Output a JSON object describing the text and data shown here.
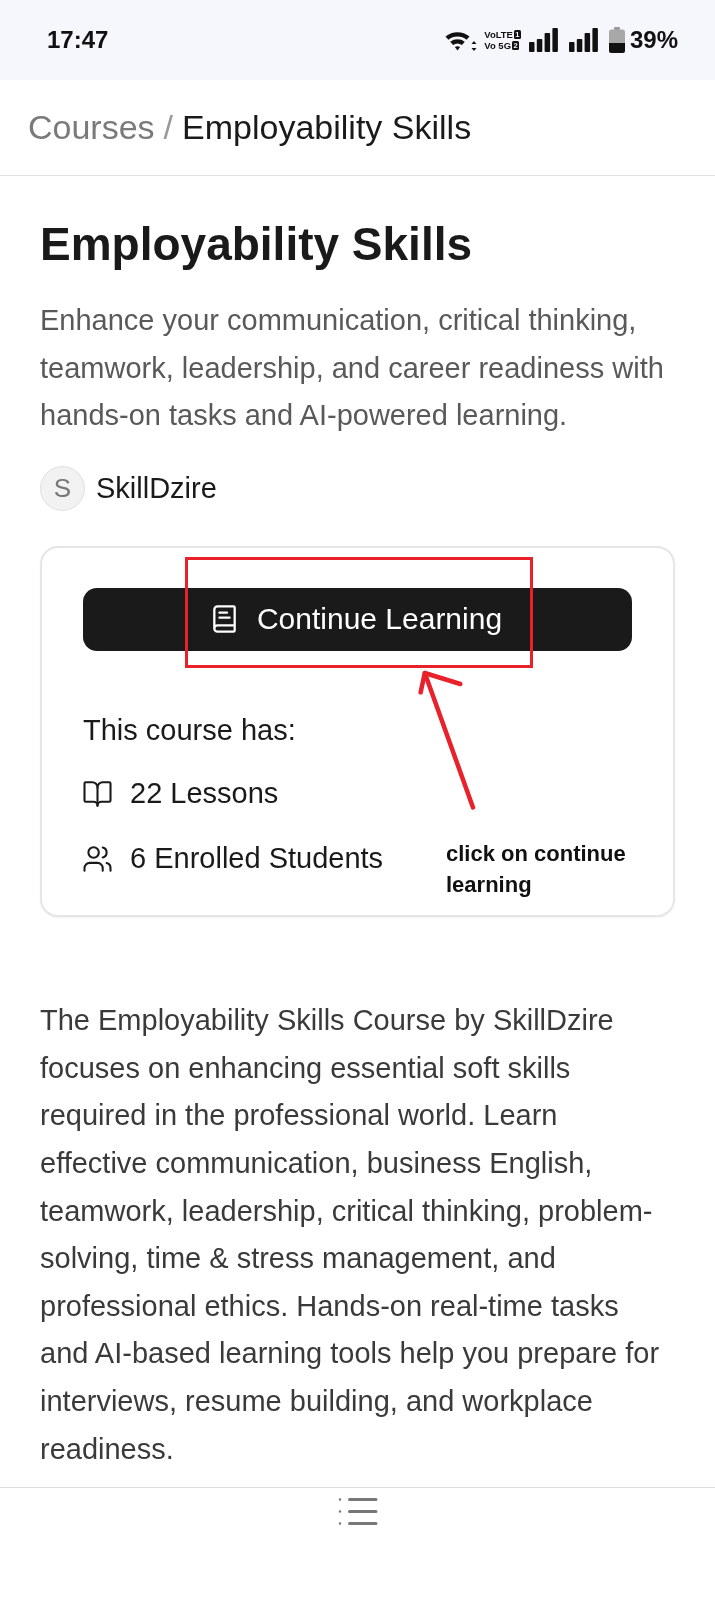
{
  "status_bar": {
    "time": "17:47",
    "networks": [
      {
        "label": "VoLTE",
        "sim": "1"
      },
      {
        "label": "Vo 5G",
        "sim": "2"
      }
    ],
    "battery": "39%"
  },
  "breadcrumb": {
    "items": [
      {
        "label": "Courses",
        "current": false
      },
      {
        "label": "Employability Skills",
        "current": true
      }
    ],
    "separator": "/"
  },
  "course": {
    "title": "Employability Skills",
    "description": "Enhance your communication, critical thinking, teamwork, leadership, and career readiness with hands-on tasks and AI-powered learning.",
    "author": {
      "initial": "S",
      "name": "SkillDzire"
    }
  },
  "card": {
    "button": {
      "label": "Continue Learning"
    },
    "heading": "This course has:",
    "features": [
      {
        "kind": "lessons",
        "label": "22 Lessons"
      },
      {
        "kind": "students",
        "label": "6 Enrolled Students"
      }
    ]
  },
  "annotation": {
    "note": "click on continue learning"
  },
  "about": "The Employability Skills Course by SkillDzire focuses on enhancing essential soft skills required in the professional world. Learn effective communication, business English, teamwork, leadership, critical thinking, problem-solving, time & stress management, and professional ethics. Hands-on real-time tasks and AI-based learning tools help you prepare for interviews, resume building, and workplace readiness."
}
